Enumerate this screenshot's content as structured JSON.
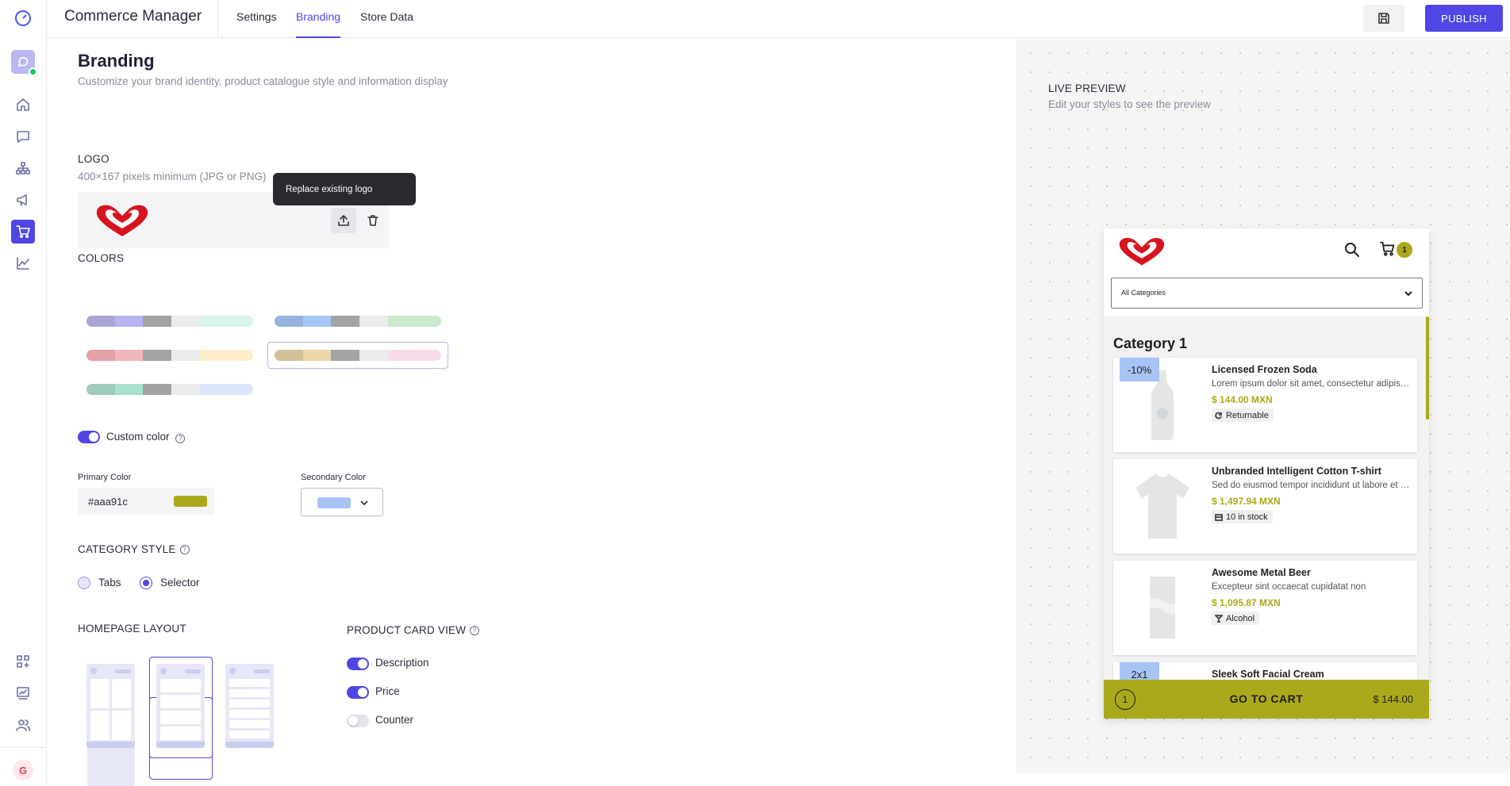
{
  "app": {
    "title": "Commerce Manager",
    "tabs": [
      {
        "label": "Settings",
        "active": false
      },
      {
        "label": "Branding",
        "active": true
      },
      {
        "label": "Store Data",
        "active": false
      }
    ],
    "publish_label": "PUBLISH"
  },
  "rail": {
    "icons": [
      "app-logo-icon",
      "whatsapp-account-icon",
      "home-icon",
      "chat-icon",
      "org-chart-icon",
      "megaphone-icon",
      "cart-icon",
      "analytics-icon",
      "apps-add-icon",
      "reports-icon",
      "users-icon"
    ],
    "active": "cart-icon",
    "user_initial": "G"
  },
  "page": {
    "title": "Branding",
    "subtitle": "Customize your brand identity, product catalogue style and information display"
  },
  "logo": {
    "label": "LOGO",
    "hint": "400×167 pixels minimum (JPG or PNG)",
    "tooltip": "Replace existing logo"
  },
  "colors": {
    "label": "COLORS",
    "palettes": [
      [
        "#a9a6d4",
        "#b6b3f0",
        "#a3a3a3",
        "#ebebeb",
        "#d8f3ea"
      ],
      [
        "#97b2dd",
        "#a6c6f5",
        "#a3a3a3",
        "#ebebeb",
        "#cbe9cc"
      ],
      [
        "#e5a1a3",
        "#f1b8b7",
        "#a3a3a3",
        "#ebebeb",
        "#fdeec9"
      ],
      [
        "#d1c299",
        "#ecd7a9",
        "#a3a3a3",
        "#ebebeb",
        "#f8dcea"
      ],
      [
        "#9fcbbb",
        "#a7e1cf",
        "#a3a3a3",
        "#ebebeb",
        "#dbe5fb"
      ]
    ],
    "selected_palette": 3,
    "custom_color_label": "Custom color",
    "custom_color_on": true,
    "primary_label": "Primary Color",
    "primary_value": "#aaa91c",
    "secondary_label": "Secondary Color",
    "secondary_value": "#a8c4f5"
  },
  "category_style": {
    "label": "CATEGORY STYLE",
    "options": [
      {
        "label": "Tabs",
        "selected": false
      },
      {
        "label": "Selector",
        "selected": true
      }
    ]
  },
  "homepage_layout": {
    "label": "HOMEPAGE LAYOUT",
    "options": [
      "grid",
      "list",
      "compact"
    ],
    "selected": 1
  },
  "product_card_view": {
    "label": "PRODUCT CARD VIEW",
    "toggles": [
      {
        "label": "Description",
        "on": true
      },
      {
        "label": "Price",
        "on": true
      },
      {
        "label": "Counter",
        "on": false
      }
    ]
  },
  "preview": {
    "title": "LIVE PREVIEW",
    "subtitle": "Edit your styles to see the preview",
    "cart_count": "1",
    "category_select": "All Categories",
    "category_title": "Category 1",
    "products": [
      {
        "name": "Licensed Frozen Soda",
        "desc": "Lorem ipsum dolor sit amet, consectetur adipiscing",
        "price": "$ 144.00 MXN",
        "tag": "Returnable",
        "tag_icon": "refresh-icon",
        "badge": "-10%",
        "image": "bottle-icon"
      },
      {
        "name": "Unbranded Intelligent Cotton T-shirt",
        "desc": "Sed do eiusmod tempor incididunt ut labore et dolore",
        "price": "$ 1,497.94 MXN",
        "tag": "10 in stock",
        "tag_icon": "box-icon",
        "badge": "",
        "image": "tshirt-icon"
      },
      {
        "name": "Awesome Metal Beer",
        "desc": "Excepteur sint occaecat cupidatat non",
        "price": "$ 1,095.87 MXN",
        "tag": "Alcohol",
        "tag_icon": "glass-icon",
        "badge": "",
        "image": "can-icon"
      },
      {
        "name": "Sleek Soft Facial Cream",
        "desc": "",
        "price": "",
        "tag": "",
        "tag_icon": "",
        "badge": "2x1",
        "image": ""
      }
    ],
    "go_to_cart": {
      "count": "1",
      "label": "GO TO CART",
      "amount": "$ 144.00"
    }
  }
}
